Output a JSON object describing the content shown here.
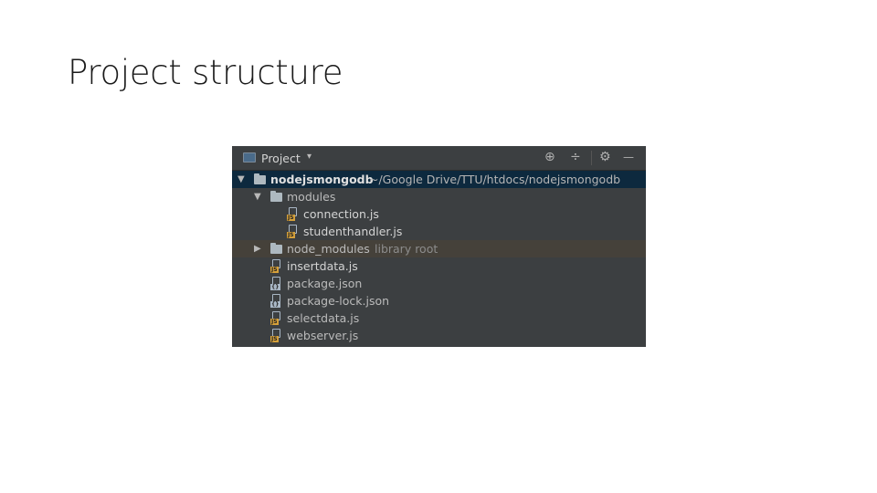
{
  "slide": {
    "title": "Project structure"
  },
  "toolbar": {
    "title": "Project",
    "caret": "▾",
    "buttons": [
      {
        "name": "locate-icon",
        "glyph": "⊕"
      },
      {
        "name": "collapse-icon",
        "glyph": "÷"
      },
      {
        "name": "gear-icon",
        "glyph": "⚙"
      },
      {
        "name": "minimize-icon",
        "glyph": "—"
      }
    ]
  },
  "tree": {
    "root": {
      "name": "nodejsmongodb",
      "path": "~/Google Drive/TTU/htdocs/nodejsmongodb",
      "arrow": "▼"
    },
    "modules": {
      "name": "modules",
      "arrow": "▼"
    },
    "connection": {
      "name": "connection.js",
      "badge": "JS"
    },
    "studenthandler": {
      "name": "studenthandler.js",
      "badge": "JS"
    },
    "node_modules": {
      "name": "node_modules",
      "note": "library root",
      "arrow": "▶"
    },
    "insertdata": {
      "name": "insertdata.js",
      "badge": "JS"
    },
    "package": {
      "name": "package.json",
      "badge": "{}"
    },
    "package_lock": {
      "name": "package-lock.json",
      "badge": "{}"
    },
    "selectdata": {
      "name": "selectdata.js",
      "badge": "JS"
    },
    "webserver": {
      "name": "webserver.js",
      "badge": "JS"
    }
  },
  "colors": {
    "panel_bg": "#3c3f41",
    "selected_bg": "#0d293e",
    "library_bg": "#45413a",
    "js_badge": "#d5a03a"
  }
}
